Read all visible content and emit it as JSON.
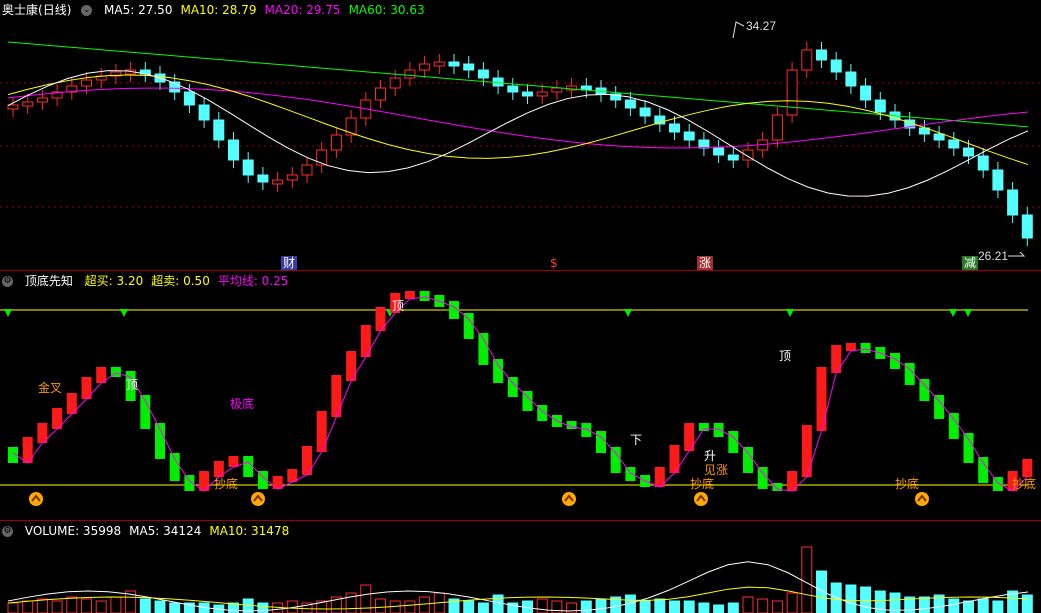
{
  "stock": {
    "name": "奥士康",
    "period": "(日线)",
    "ma_labels": [
      {
        "text": "MA5: 27.50",
        "color": "#ffffff"
      },
      {
        "text": "MA10: 28.79",
        "color": "#ffff00"
      },
      {
        "text": "MA20: 29.75",
        "color": "#ff00ff"
      },
      {
        "text": "MA60: 30.63",
        "color": "#00ff00"
      }
    ],
    "high_label": "34.27",
    "low_label": "26.21",
    "event_tags": [
      {
        "text": "财",
        "bg": "#3a3aa0",
        "color": "#ffffff"
      },
      {
        "text": "$",
        "bg": "#000000",
        "color": "#ff3b3b"
      },
      {
        "text": "涨",
        "bg": "#a03030",
        "color": "#ffffff"
      },
      {
        "text": "减",
        "bg": "#2a7a2a",
        "color": "#ffffff"
      }
    ]
  },
  "indicator": {
    "name": "顶底先知",
    "params": [
      {
        "text": "超买: 3.20",
        "color": "#ffff00"
      },
      {
        "text": "超卖: 0.50",
        "color": "#ffff00"
      },
      {
        "text": "平均线: 0.25",
        "color": "#ff00ff"
      }
    ],
    "labels": [
      {
        "text": "金叉",
        "color": "#ff9900"
      },
      {
        "text": "极底",
        "color": "#ff00ff"
      },
      {
        "text": "顶",
        "color": "#ffffff"
      },
      {
        "text": "顶",
        "color": "#ffffff"
      },
      {
        "text": "顶",
        "color": "#ffffff"
      },
      {
        "text": "下",
        "color": "#ffffff"
      },
      {
        "text": "升",
        "color": "#ffffff"
      },
      {
        "text": "见涨",
        "color": "#ff9900"
      },
      {
        "text": "抄底",
        "color": "#ff9900"
      },
      {
        "text": "抄底",
        "color": "#ff9900"
      },
      {
        "text": "抄底",
        "color": "#ff9900"
      },
      {
        "text": "抄底",
        "color": "#ff9900"
      }
    ]
  },
  "volume": {
    "labels": [
      {
        "text": "VOLUME: 35998",
        "color": "#ffffff"
      },
      {
        "text": "MA5: 34124",
        "color": "#ffffff"
      },
      {
        "text": "MA10: 31478",
        "color": "#ffff00"
      }
    ]
  },
  "colors": {
    "up": "#ff2a2a",
    "down": "#54ffff",
    "grid": "#a00000",
    "ma5": "#ffffff",
    "ma10": "#ffff00",
    "ma20": "#ff00ff",
    "ma60": "#00ff00",
    "ind_up": "#ff1a1a",
    "ind_down": "#00ee00",
    "ind_line": "#ff00ff",
    "threshold": "#ffff00"
  }
}
